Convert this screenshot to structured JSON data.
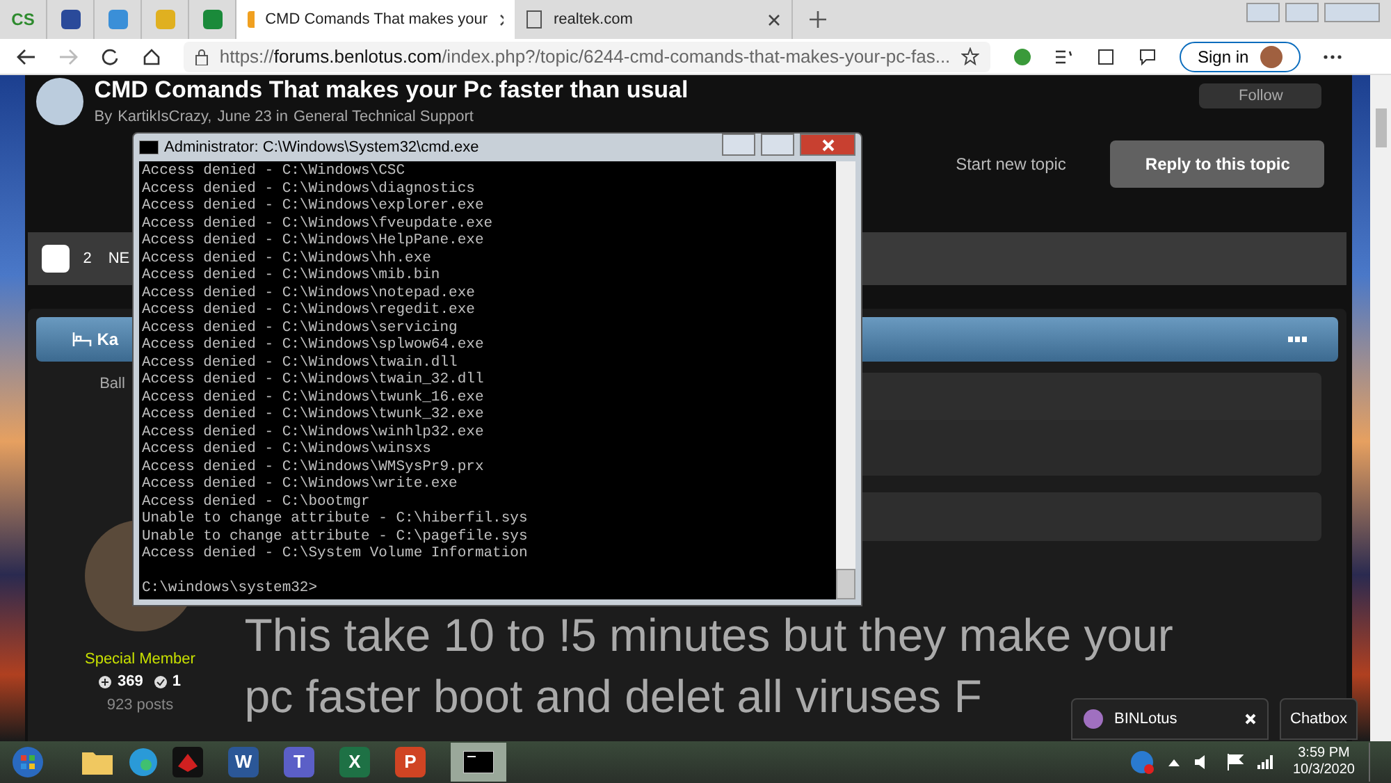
{
  "browser": {
    "pinned_tab_label": "CS",
    "tabs": [
      {
        "title": "CMD Comands That makes your",
        "selected": true
      },
      {
        "title": "realtek.com",
        "selected": false
      }
    ],
    "url_prefix": "https://",
    "url_host": "forums.benlotus.com",
    "url_path": "/index.php?/topic/6244-cmd-comands-that-makes-your-pc-fas...",
    "sign_in": "Sign in"
  },
  "forum": {
    "title": "CMD Comands That makes your Pc faster than usual",
    "byline": [
      "By",
      "KartikIsCrazy,",
      "June 23 in",
      "General Technical Support"
    ],
    "follow": "Follow",
    "start_topic": "Start new topic",
    "reply": "Reply to this topic",
    "page_checkbox": {
      "checked": false
    },
    "page_count": "2",
    "page_label": "NE",
    "post": {
      "author": "Ka",
      "rank": "Ball",
      "member_title": "Special Member",
      "reputation": "369",
      "badges": "1",
      "posts": "923 posts",
      "body": [
        "This take 10 to !5 minutes but they make your",
        "pc faster boot and delet all viruses F"
      ]
    }
  },
  "cmd": {
    "title": "Administrator: C:\\Windows\\System32\\cmd.exe",
    "lines": [
      "Access denied - C:\\Windows\\CSC",
      "Access denied - C:\\Windows\\diagnostics",
      "Access denied - C:\\Windows\\explorer.exe",
      "Access denied - C:\\Windows\\fveupdate.exe",
      "Access denied - C:\\Windows\\HelpPane.exe",
      "Access denied - C:\\Windows\\hh.exe",
      "Access denied - C:\\Windows\\mib.bin",
      "Access denied - C:\\Windows\\notepad.exe",
      "Access denied - C:\\Windows\\regedit.exe",
      "Access denied - C:\\Windows\\servicing",
      "Access denied - C:\\Windows\\splwow64.exe",
      "Access denied - C:\\Windows\\twain.dll",
      "Access denied - C:\\Windows\\twain_32.dll",
      "Access denied - C:\\Windows\\twunk_16.exe",
      "Access denied - C:\\Windows\\twunk_32.exe",
      "Access denied - C:\\Windows\\winhlp32.exe",
      "Access denied - C:\\Windows\\winsxs",
      "Access denied - C:\\Windows\\WMSysPr9.prx",
      "Access denied - C:\\Windows\\write.exe",
      "Access denied - C:\\bootmgr",
      "Unable to change attribute - C:\\hiberfil.sys",
      "Unable to change attribute - C:\\pagefile.sys",
      "Access denied - C:\\System Volume Information"
    ],
    "prompt": "C:\\windows\\system32>"
  },
  "chat": {
    "user": "BINLotus",
    "chatbox": "Chatbox"
  },
  "taskbar": {
    "apps": [
      {
        "letter": "W",
        "color": "#2b5797"
      },
      {
        "letter": "T",
        "color": "#5b5fc7"
      },
      {
        "letter": "X",
        "color": "#1e7145"
      },
      {
        "letter": "P",
        "color": "#d04423"
      }
    ],
    "time": "3:59 PM",
    "date": "10/3/2020"
  }
}
